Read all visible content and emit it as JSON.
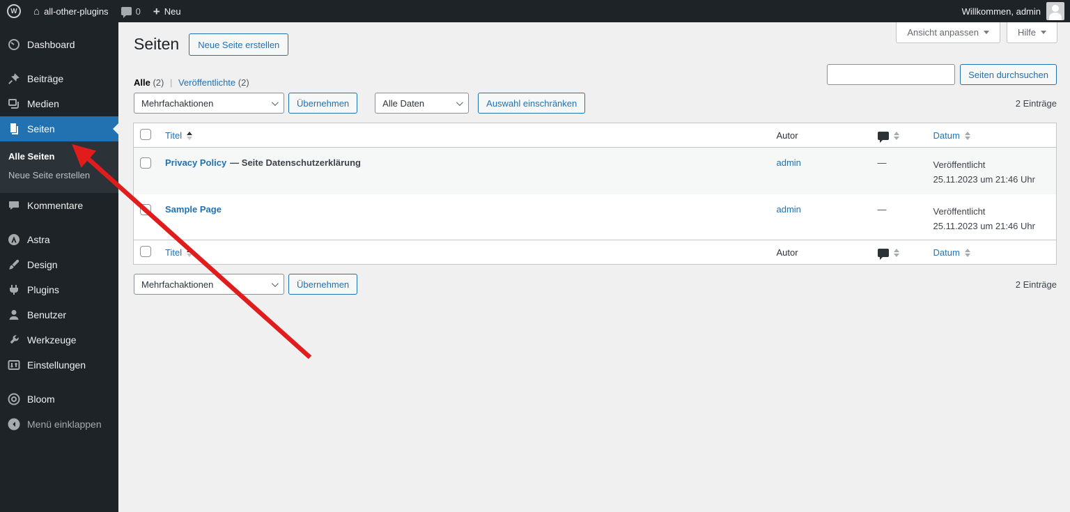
{
  "colors": {
    "topbar_bg": "#1d2327",
    "active_menu": "#2271b1",
    "link": "#2271b1",
    "content_bg": "#f0f0f1",
    "table_border": "#c3c4c7",
    "row_alt": "#f6f7f7",
    "annotation_arrow": "#e01c1c"
  },
  "icons": {
    "home": "⌂",
    "plus": "+",
    "wp_logo_letter": "W"
  },
  "topbar": {
    "site_name": "all-other-plugins",
    "comments_count": "0",
    "new_label": "Neu",
    "welcome": "Willkommen, admin"
  },
  "screen_tabs": {
    "customize": "Ansicht anpassen",
    "help": "Hilfe"
  },
  "sidebar": {
    "items": [
      {
        "label": "Dashboard"
      },
      {
        "label": "Beiträge"
      },
      {
        "label": "Medien"
      },
      {
        "label": "Seiten"
      },
      {
        "label": "Kommentare"
      },
      {
        "label": "Astra"
      },
      {
        "label": "Design"
      },
      {
        "label": "Plugins"
      },
      {
        "label": "Benutzer"
      },
      {
        "label": "Werkzeuge"
      },
      {
        "label": "Einstellungen"
      },
      {
        "label": "Bloom"
      }
    ],
    "submenu": [
      {
        "label": "Alle Seiten"
      },
      {
        "label": "Neue Seite erstellen"
      }
    ],
    "collapse_label": "Menü einklappen"
  },
  "page": {
    "title": "Seiten",
    "add_new": "Neue Seite erstellen",
    "views": {
      "all_label": "Alle",
      "all_count": "(2)",
      "published_label": "Veröffentlichte",
      "published_count": "(2)"
    },
    "search_button": "Seiten durchsuchen",
    "bulk_select": "Mehrfachaktionen",
    "apply_button": "Übernehmen",
    "date_select": "Alle Daten",
    "filter_button": "Auswahl einschränken",
    "entries_count": "2 Einträge"
  },
  "table": {
    "headers": {
      "title": "Titel",
      "author": "Autor",
      "date": "Datum"
    },
    "rows": [
      {
        "title": "Privacy Policy",
        "title_suffix": "— Seite Datenschutzerklärung",
        "author": "admin",
        "comments": "—",
        "status": "Veröffentlicht",
        "date": "25.11.2023 um 21:46 Uhr"
      },
      {
        "title": "Sample Page",
        "title_suffix": "",
        "author": "admin",
        "comments": "—",
        "status": "Veröffentlicht",
        "date": "25.11.2023 um 21:46 Uhr"
      }
    ]
  }
}
